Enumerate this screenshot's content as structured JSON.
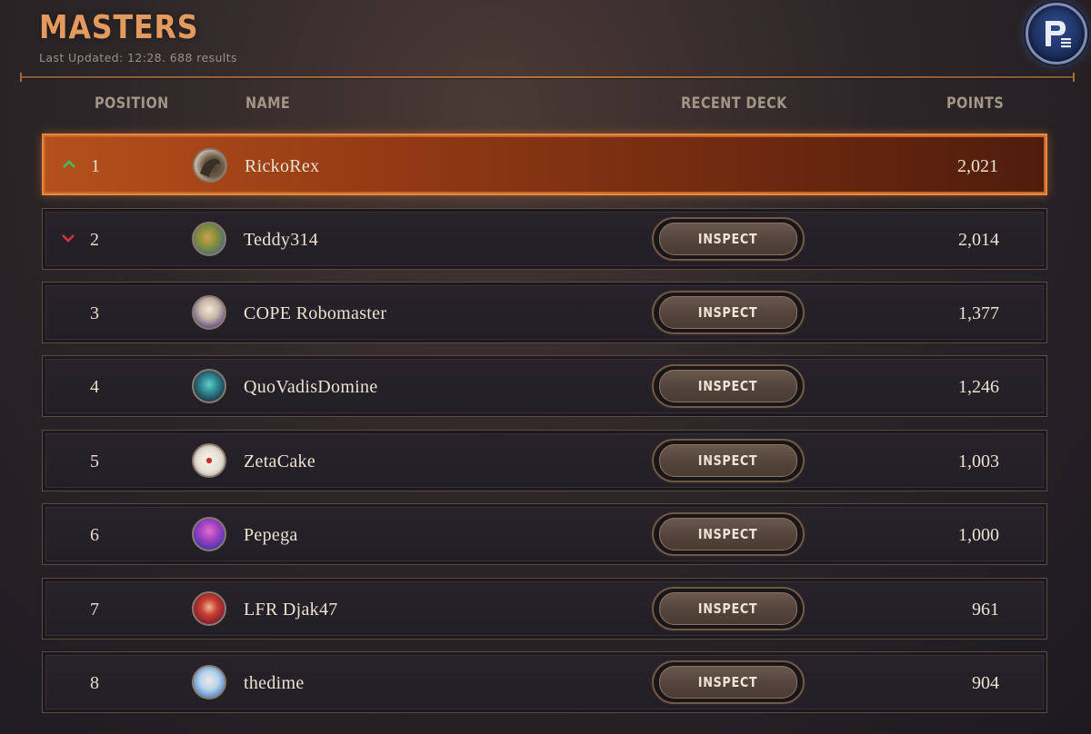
{
  "header": {
    "title": "MASTERS",
    "subtitle": "Last Updated: 12:28. 688 results"
  },
  "columns": {
    "position": "POSITION",
    "name": "NAME",
    "recent_deck": "RECENT DECK",
    "points": "POINTS"
  },
  "inspect_label": "INSPECT",
  "rows": [
    {
      "position": "1",
      "name": "RickoRex",
      "points": "2,021",
      "trend": "up",
      "active": true
    },
    {
      "position": "2",
      "name": "Teddy314",
      "points": "2,014",
      "trend": "down"
    },
    {
      "position": "3",
      "name": "COPE Robomaster",
      "points": "1,377"
    },
    {
      "position": "4",
      "name": "QuoVadisDomine",
      "points": "1,246"
    },
    {
      "position": "5",
      "name": "ZetaCake",
      "points": "1,003"
    },
    {
      "position": "6",
      "name": "Pepega",
      "points": "1,000"
    },
    {
      "position": "7",
      "name": "LFR Djak47",
      "points": "961"
    },
    {
      "position": "8",
      "name": "thedime",
      "points": "904"
    }
  ],
  "colors": {
    "accent": "#e39a5e",
    "trend_up": "#3fbf5a",
    "trend_down": "#d2343a",
    "active_row": "#b5501c"
  },
  "icons": {
    "trend_up": "chevron-up-icon",
    "trend_down": "chevron-down-icon",
    "badge": "profile-menu-icon"
  }
}
